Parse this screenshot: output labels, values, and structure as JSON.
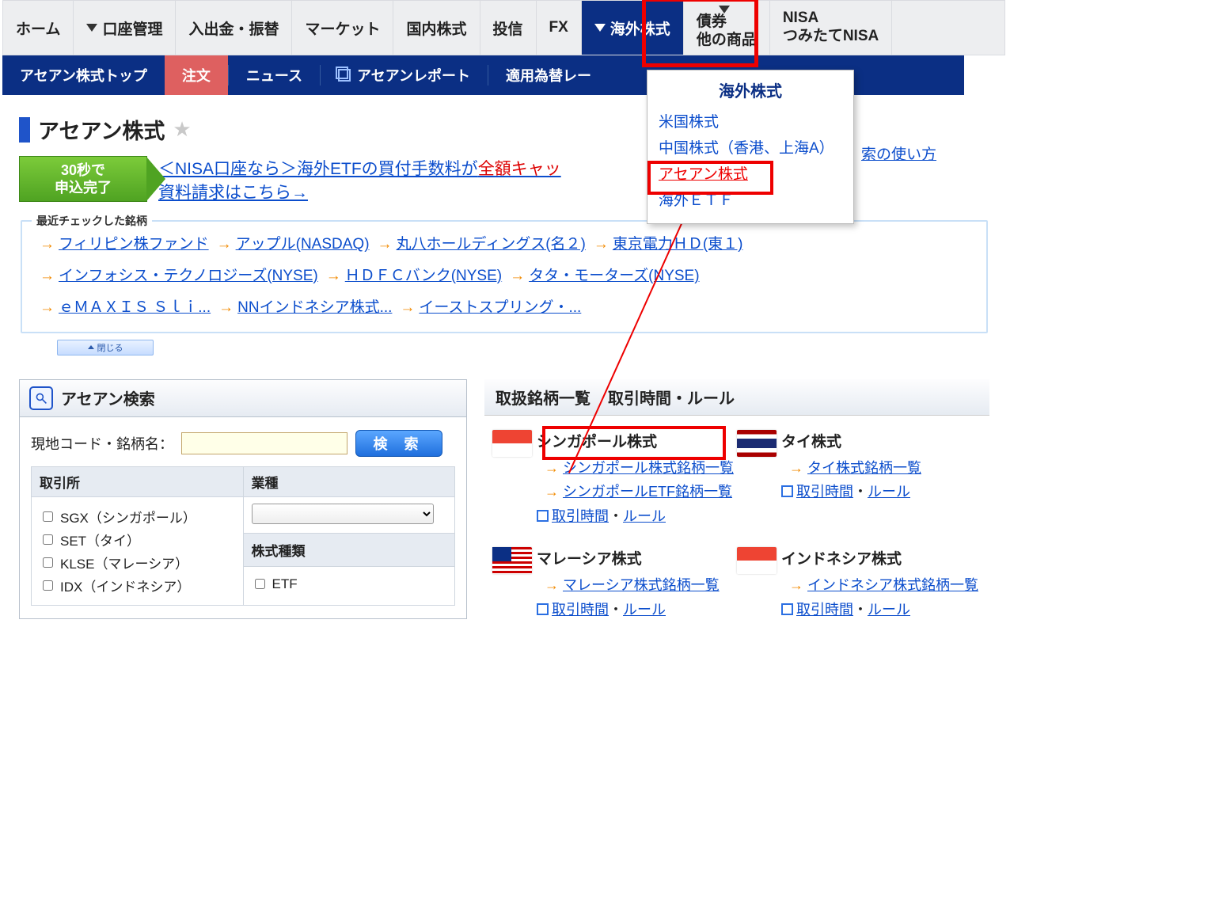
{
  "topnav": [
    {
      "label": "ホーム",
      "drop": false
    },
    {
      "label": "口座管理",
      "drop": true
    },
    {
      "label": "入出金・振替",
      "drop": false
    },
    {
      "label": "マーケット",
      "drop": false
    },
    {
      "label": "国内株式",
      "drop": false
    },
    {
      "label": "投信",
      "drop": false
    },
    {
      "label": "FX",
      "drop": false
    },
    {
      "label": "海外株式",
      "drop": true,
      "active": true
    },
    {
      "label": "債券\n他の商品",
      "drop": true,
      "two": true
    },
    {
      "label": "NISA\nつみたてNISA",
      "two": true
    }
  ],
  "subnav": [
    {
      "label": "アセアン株式トップ"
    },
    {
      "label": "注文",
      "order": true
    },
    {
      "label": "ニュース"
    },
    {
      "label": "アセアンレポート",
      "open": true
    },
    {
      "label": "適用為替レー"
    }
  ],
  "dropdown": {
    "head": "海外株式",
    "items": [
      "米国株式",
      "中国株式（香港、上海A）",
      "アセアン株式",
      "海外ＥＴＦ"
    ],
    "selected": 2
  },
  "page_title": "アセアン株式",
  "promo": {
    "badge": "30秒で\n申込完了",
    "line1_a": "＜NISA口座なら＞海外ETFの買付手数料が",
    "line1_b": "全額キャッ",
    "line2": "資料請求はこちら→"
  },
  "help_link": "索の使い方",
  "recent": {
    "legend": "最近チェックした銘柄",
    "rows": [
      [
        "フィリピン株ファンド",
        "アップル(NASDAQ)",
        "丸八ホールディングス(名２)",
        "東京電力ＨＤ(東１)"
      ],
      [
        "インフォシス・テクノロジーズ(NYSE)",
        "ＨＤＦＣバンク(NYSE)",
        "タタ・モーターズ(NYSE)"
      ],
      [
        "ｅＭＡＸＩＳ Ｓｌｉ...",
        "NNインドネシア株式...",
        "イーストスプリング・..."
      ]
    ],
    "close": "閉じる"
  },
  "search": {
    "title": "アセアン検索",
    "label": "現地コード・銘柄名：",
    "button": "検 索",
    "exchange_head": "取引所",
    "industry_head": "業種",
    "type_head": "株式種類",
    "exchanges": [
      "SGX（シンガポール）",
      "SET（タイ）",
      "KLSE（マレーシア）",
      "IDX（インドネシア）"
    ],
    "etf": "ETF"
  },
  "right": {
    "tab1": "取扱銘柄一覧",
    "tab2": "取引時間・ルール",
    "markets": [
      {
        "flag": "sg",
        "title": "シンガポール株式",
        "links": [
          "シンガポール株式銘柄一覧",
          "シンガポールETF銘柄一覧"
        ],
        "rule": "取引時間・ルール"
      },
      {
        "flag": "th",
        "title": "タイ株式",
        "links": [
          "タイ株式銘柄一覧"
        ],
        "rule": "取引時間・ルール"
      },
      {
        "flag": "my",
        "title": "マレーシア株式",
        "links": [
          "マレーシア株式銘柄一覧"
        ],
        "rule": "取引時間・ルール"
      },
      {
        "flag": "idf",
        "title": "インドネシア株式",
        "links": [
          "インドネシア株式銘柄一覧"
        ],
        "rule": "取引時間・ルール"
      }
    ],
    "dot": "・"
  }
}
